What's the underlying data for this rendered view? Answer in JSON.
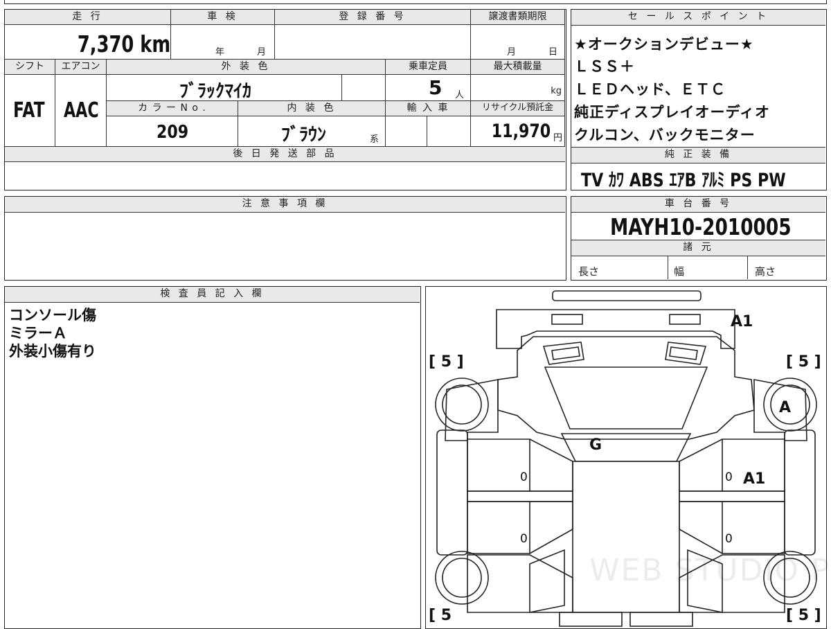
{
  "headers": {
    "mileage": "走 行",
    "shaken": "車 検",
    "registration": "登 録 番 号",
    "transfer_deadline": "譲渡書類期限",
    "shift": "シフト",
    "aircon": "エアコン",
    "exterior_color": "外 装 色",
    "capacity": "乗車定員",
    "max_load": "最大積載量",
    "color_no": "カ ラ ー N o .",
    "interior_color": "内 装 色",
    "import": "輸 入 車",
    "recycle": "リサイクル預託金",
    "later_parts": "後 日 発 送 部 品",
    "notes": "注 意 事 項 欄",
    "sales_points": "セ ー ル ス ポ イ ン ト",
    "genuine_equipment": "純 正 装 備",
    "chassis_number": "車 台 番 号",
    "specs": "諸 元",
    "inspector": "検 査 員 記 入 欄"
  },
  "vehicle": {
    "mileage": "7,370 km",
    "shaken_year_unit": "年",
    "shaken_month_unit": "月",
    "transfer_month_unit": "月",
    "transfer_day_unit": "日",
    "shift": "FAT",
    "aircon": "AAC",
    "exterior_color": "ﾌﾞﾗｯｸﾏｲｶ",
    "capacity": "5",
    "capacity_unit": "人",
    "max_load_unit": "kg",
    "color_no": "209",
    "interior_color": "ﾌﾞﾗｳﾝ",
    "interior_suffix": "系",
    "recycle_fee": "11,970",
    "recycle_unit": "円"
  },
  "sales_points": [
    "★オークションデビュー★",
    "ＬＳＳ＋",
    "ＬＥＤヘッド、ＥＴＣ",
    "純正ディスプレイオーディオ",
    "クルコン、バックモニター"
  ],
  "equipment": "TV ｶﾜ ABS ｴｱB ｱﾙﾐ PS PW",
  "chassis_number": "MAYH10-2010005",
  "specs": {
    "length": "長さ",
    "width": "幅",
    "height": "高さ"
  },
  "inspector_notes": [
    "コンソール傷",
    "ミラーＡ",
    "外装小傷有り"
  ],
  "diagram": {
    "tire_front_left": "[ 5 ]",
    "tire_front_right": "[ 5 ]",
    "tire_rear_left": "[ 5",
    "tire_rear_right": "[ 5 ]",
    "mark_rear_bumper": "A1",
    "mark_right_front_fender": "A",
    "mark_windshield": "G",
    "mark_right_front_door": "A1",
    "door_lf": "0",
    "door_lr": "0",
    "door_rf": "0",
    "door_rr": "0",
    "watermark": "WEB STUDIO PRO"
  }
}
